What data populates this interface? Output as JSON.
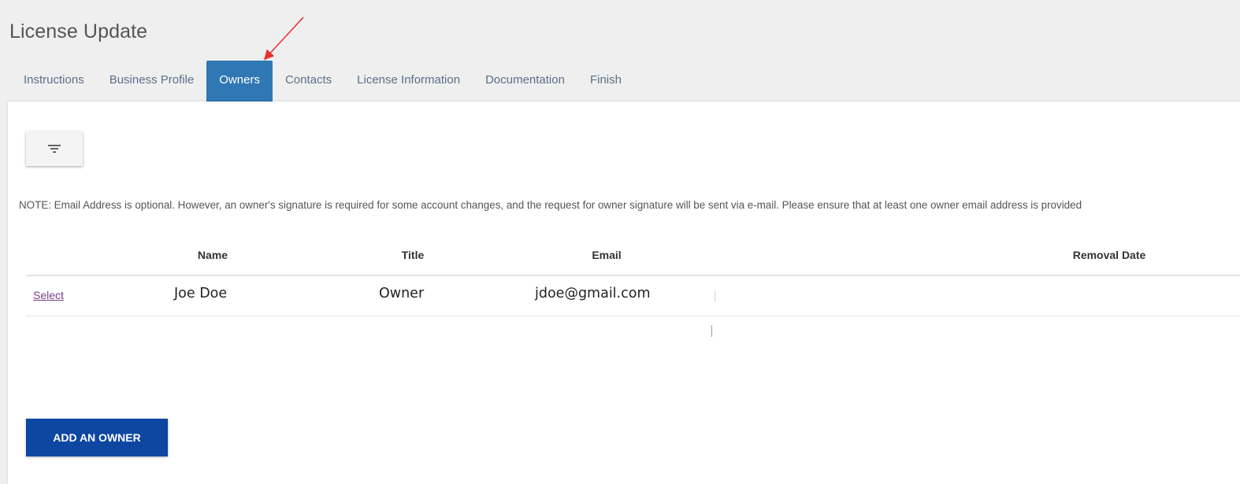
{
  "page": {
    "title": "License Update"
  },
  "tabs": [
    {
      "label": "Instructions",
      "active": false
    },
    {
      "label": "Business Profile",
      "active": false
    },
    {
      "label": "Owners",
      "active": true
    },
    {
      "label": "Contacts",
      "active": false
    },
    {
      "label": "License Information",
      "active": false
    },
    {
      "label": "Documentation",
      "active": false
    },
    {
      "label": "Finish",
      "active": false
    }
  ],
  "toolbar": {
    "filter_icon": "filter-lines-icon"
  },
  "note": "NOTE: Email Address is optional. However, an owner's signature is required for some account changes, and the request for owner signature will be sent via e-mail. Please ensure that at least one owner email address is provided",
  "table": {
    "columns": [
      "Name",
      "Title",
      "Email",
      "Removal Date"
    ],
    "rows": [
      {
        "action": "Select",
        "name": "Joe Doe",
        "title": "Owner",
        "email": "jdoe@gmail.com",
        "removal_date": ""
      }
    ]
  },
  "actions": {
    "add_owner_label": "ADD AN OWNER"
  },
  "colors": {
    "active_tab": "#2f78b4",
    "primary_button": "#0d47a1",
    "link": "#7a3f8c",
    "annotation_arrow": "#e53030"
  }
}
